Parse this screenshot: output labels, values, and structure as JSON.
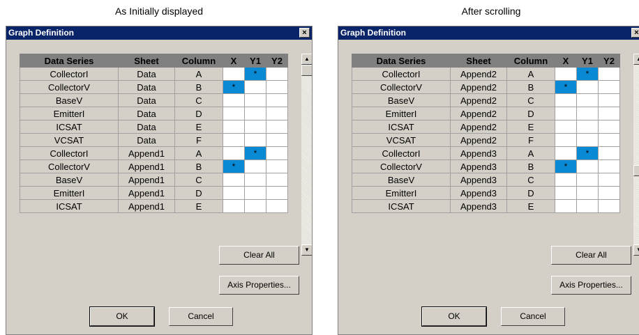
{
  "captions": {
    "left": "As Initially displayed",
    "right": "After scrolling"
  },
  "dialog_title": "Graph Definition",
  "close_glyph": "×",
  "columns": [
    "Data Series",
    "Sheet",
    "Column",
    "X",
    "Y1",
    "Y2"
  ],
  "scroll_up_glyph": "▲",
  "scroll_down_glyph": "▼",
  "selected_mark": "*",
  "left_rows": [
    {
      "series": "CollectorI",
      "sheet": "Data",
      "column": "A",
      "x": "",
      "y1": "*",
      "y2": ""
    },
    {
      "series": "CollectorV",
      "sheet": "Data",
      "column": "B",
      "x": "*",
      "y1": "",
      "y2": ""
    },
    {
      "series": "BaseV",
      "sheet": "Data",
      "column": "C",
      "x": "",
      "y1": "",
      "y2": ""
    },
    {
      "series": "EmitterI",
      "sheet": "Data",
      "column": "D",
      "x": "",
      "y1": "",
      "y2": ""
    },
    {
      "series": "ICSAT",
      "sheet": "Data",
      "column": "E",
      "x": "",
      "y1": "",
      "y2": ""
    },
    {
      "series": "VCSAT",
      "sheet": "Data",
      "column": "F",
      "x": "",
      "y1": "",
      "y2": ""
    },
    {
      "series": "CollectorI",
      "sheet": "Append1",
      "column": "A",
      "x": "",
      "y1": "*",
      "y2": ""
    },
    {
      "series": "CollectorV",
      "sheet": "Append1",
      "column": "B",
      "x": "*",
      "y1": "",
      "y2": ""
    },
    {
      "series": "BaseV",
      "sheet": "Append1",
      "column": "C",
      "x": "",
      "y1": "",
      "y2": ""
    },
    {
      "series": "EmitterI",
      "sheet": "Append1",
      "column": "D",
      "x": "",
      "y1": "",
      "y2": ""
    },
    {
      "series": "ICSAT",
      "sheet": "Append1",
      "column": "E",
      "x": "",
      "y1": "",
      "y2": ""
    }
  ],
  "right_rows": [
    {
      "series": "CollectorI",
      "sheet": "Append2",
      "column": "A",
      "x": "",
      "y1": "*",
      "y2": ""
    },
    {
      "series": "CollectorV",
      "sheet": "Append2",
      "column": "B",
      "x": "*",
      "y1": "",
      "y2": ""
    },
    {
      "series": "BaseV",
      "sheet": "Append2",
      "column": "C",
      "x": "",
      "y1": "",
      "y2": ""
    },
    {
      "series": "EmitterI",
      "sheet": "Append2",
      "column": "D",
      "x": "",
      "y1": "",
      "y2": ""
    },
    {
      "series": "ICSAT",
      "sheet": "Append2",
      "column": "E",
      "x": "",
      "y1": "",
      "y2": ""
    },
    {
      "series": "VCSAT",
      "sheet": "Append2",
      "column": "F",
      "x": "",
      "y1": "",
      "y2": ""
    },
    {
      "series": "CollectorI",
      "sheet": "Append3",
      "column": "A",
      "x": "",
      "y1": "*",
      "y2": ""
    },
    {
      "series": "CollectorV",
      "sheet": "Append3",
      "column": "B",
      "x": "*",
      "y1": "",
      "y2": ""
    },
    {
      "series": "BaseV",
      "sheet": "Append3",
      "column": "C",
      "x": "",
      "y1": "",
      "y2": ""
    },
    {
      "series": "EmitterI",
      "sheet": "Append3",
      "column": "D",
      "x": "",
      "y1": "",
      "y2": ""
    },
    {
      "series": "ICSAT",
      "sheet": "Append3",
      "column": "E",
      "x": "",
      "y1": "",
      "y2": ""
    }
  ],
  "buttons": {
    "clear_all": "Clear All",
    "axis_properties": "Axis Properties...",
    "ok": "OK",
    "cancel": "Cancel"
  },
  "colors": {
    "title_bar": "#0a246a",
    "selected_cell": "#0a8ad4",
    "header_bg": "#808080",
    "dialog_bg": "#d4d0c8"
  }
}
